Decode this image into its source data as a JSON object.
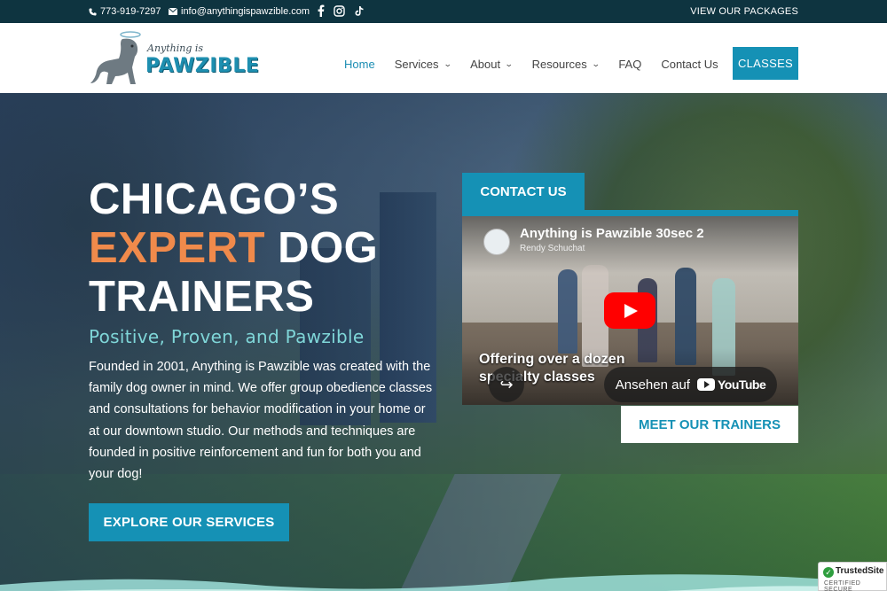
{
  "topbar": {
    "phone": "773-919-7297",
    "email": "info@anythingispawzible.com",
    "packages_link": "VIEW OUR PACKAGES",
    "social_icons": [
      "facebook-icon",
      "instagram-icon",
      "tiktok-icon"
    ]
  },
  "logo": {
    "small_text": "Anything is",
    "big_text": "PAWZIBLE"
  },
  "nav": {
    "items": [
      {
        "label": "Home",
        "active": true,
        "dropdown": false
      },
      {
        "label": "Services",
        "active": false,
        "dropdown": true
      },
      {
        "label": "About",
        "active": false,
        "dropdown": true
      },
      {
        "label": "Resources",
        "active": false,
        "dropdown": true
      },
      {
        "label": "FAQ",
        "active": false,
        "dropdown": false
      },
      {
        "label": "Contact Us",
        "active": false,
        "dropdown": false
      }
    ],
    "classes_button": "CLASSES"
  },
  "hero": {
    "headline_line1": "CHICAGO’S",
    "headline_accent": "EXPERT",
    "headline_line2_rest": " DOG",
    "headline_line3": "TRAINERS",
    "tagline": "Positive, Proven, and Pawzible",
    "intro": "Founded in 2001, Anything is Pawzible was created with the family dog owner in mind. We offer group obedience classes and consultations for behavior modification in your home or at our downtown studio. Our methods and techniques are founded in positive reinforcement and fun for both you and your dog!",
    "explore_button": "EXPLORE OUR SERVICES",
    "contact_button": "CONTACT US",
    "trainers_button": "MEET OUR TRAINERS"
  },
  "video": {
    "title": "Anything is Pawzible 30sec 2",
    "author": "Rendy Schuchat",
    "caption_line1": "Offering over a dozen",
    "caption_line2": "specialty classes",
    "watch_label": "Ansehen auf",
    "platform": "YouTube"
  },
  "trusted_badge": {
    "name": "TrustedSite",
    "sub": "CERTIFIED SECURE"
  },
  "colors": {
    "accent_blue": "#1591b5",
    "accent_orange": "#f08a4b",
    "tagline_teal": "#7fd6d8",
    "topbar": "#0e3440"
  }
}
